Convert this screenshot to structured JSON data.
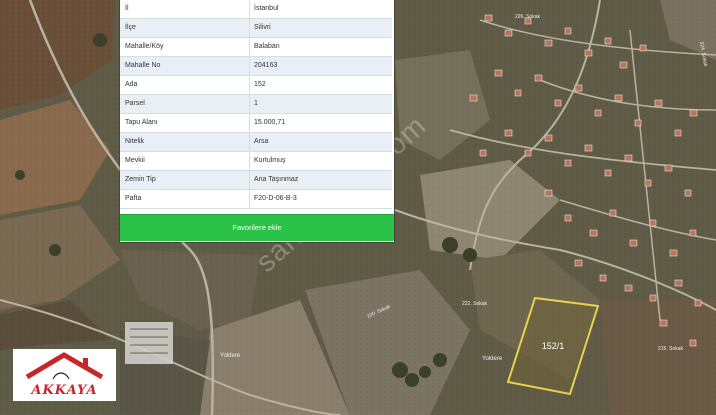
{
  "parcel": {
    "rows": [
      {
        "key": "İl",
        "value": "İstanbul"
      },
      {
        "key": "İlçe",
        "value": "Silivri"
      },
      {
        "key": "Mahalle/Köy",
        "value": "Balaban"
      },
      {
        "key": "Mahalle No",
        "value": "204163"
      },
      {
        "key": "Ada",
        "value": "152"
      },
      {
        "key": "Parsel",
        "value": "1"
      },
      {
        "key": "Tapu Alanı",
        "value": "15.000,71"
      },
      {
        "key": "Nitelik",
        "value": "Arsa"
      },
      {
        "key": "Mevkii",
        "value": "Kurtulmuş"
      },
      {
        "key": "Zemin Tip",
        "value": "Ana Taşınmaz"
      },
      {
        "key": "Pafta",
        "value": "F20-D-06-B-3"
      }
    ],
    "favorite_label": "Favorilere ekle"
  },
  "map": {
    "parcel_label": "152/1",
    "place_labels": [
      "Yoldere",
      "Yoldere"
    ],
    "road_labels": [
      "220. Sokak",
      "222. Sokak",
      "224. Sokak",
      "226. Sokak",
      "215. Sokak"
    ],
    "watermark": "sahibinden.com",
    "colors": {
      "parcel_outline": "#e7d24a",
      "favorite_button": "#29c146"
    }
  },
  "logo": {
    "text": "AKKAYA",
    "color": "#c8262b"
  }
}
